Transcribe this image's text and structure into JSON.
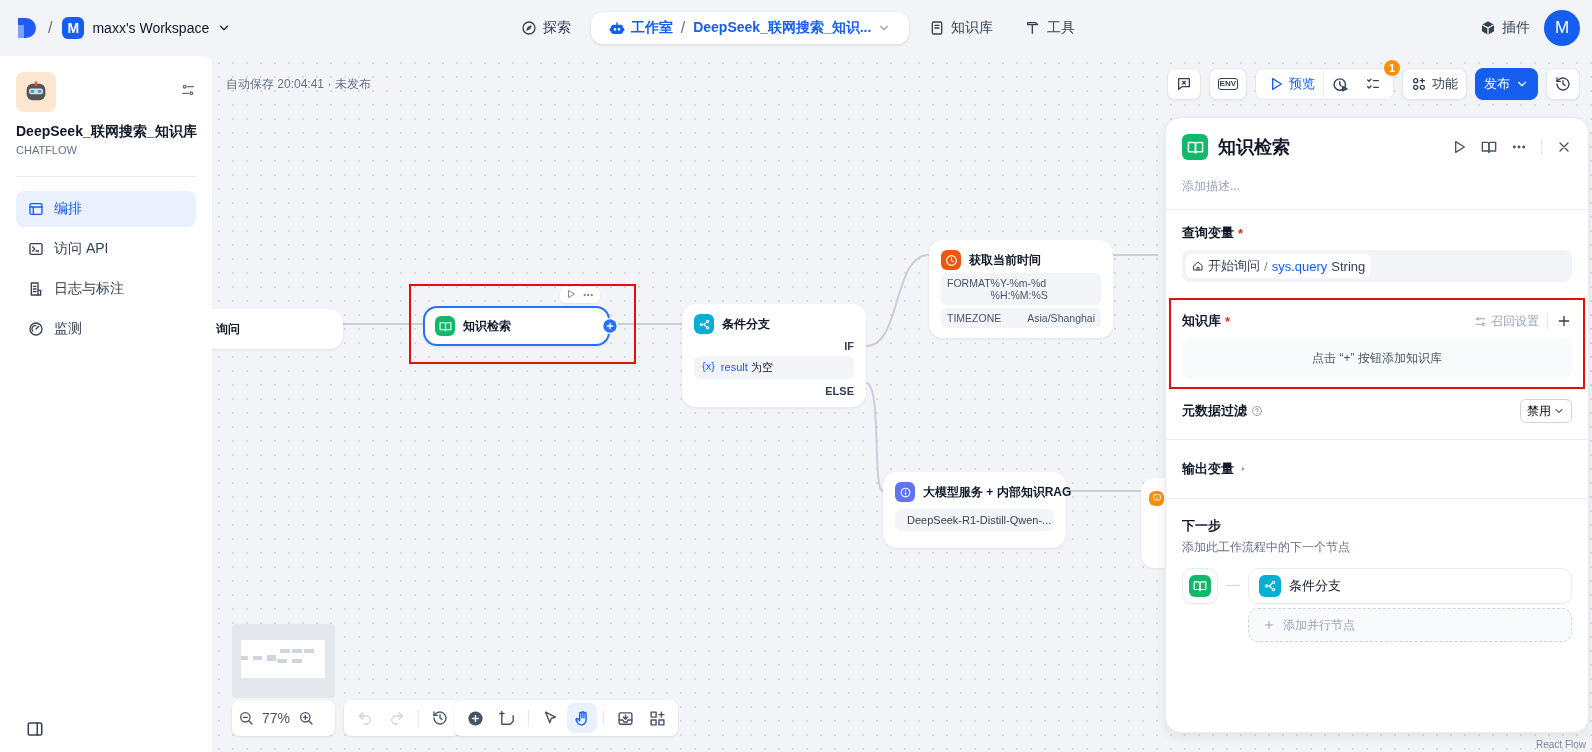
{
  "top_nav": {
    "separator": "/",
    "workspace": {
      "initial": "M",
      "name": "maxx's Workspace"
    },
    "items": [
      {
        "kind": "explore",
        "label": "探索",
        "selected": false
      },
      {
        "kind": "studio",
        "label": "工作室",
        "selected": true,
        "current_app": "DeepSeek_联网搜索_知识..."
      },
      {
        "kind": "knowledge",
        "label": "知识库",
        "selected": false
      },
      {
        "kind": "tools",
        "label": "工具",
        "selected": false
      }
    ],
    "plugins": "插件",
    "avatar": "M"
  },
  "sidebar": {
    "app_name": "DeepSeek_联网搜索_知识库",
    "app_type": "CHATFLOW",
    "items": [
      {
        "kind": "orchestrate",
        "label": "编排",
        "selected": true
      },
      {
        "kind": "api",
        "label": "访问 API",
        "selected": false
      },
      {
        "kind": "logs",
        "label": "日志与标注",
        "selected": false
      },
      {
        "kind": "monitor",
        "label": "监测",
        "selected": false
      }
    ]
  },
  "canvas": {
    "status": "自动保存 20:04:41 · 未发布",
    "header_actions": [
      {
        "kind": "conversation_vars"
      },
      {
        "kind": "env",
        "label": "ENV"
      },
      {
        "kind": "preview",
        "label": "预览"
      },
      {
        "kind": "run_history"
      },
      {
        "kind": "checklist",
        "badge": "1"
      },
      {
        "kind": "features",
        "label": "功能"
      },
      {
        "kind": "publish",
        "label": "发布"
      },
      {
        "kind": "versions"
      }
    ],
    "nodes": [
      {
        "kind": "start",
        "title": "询问",
        "selected": false,
        "highlighted": false
      },
      {
        "kind": "knowledge",
        "title": "知识检索",
        "selected": true,
        "highlighted": true
      },
      {
        "kind": "if_else",
        "title": "条件分支",
        "selected": false,
        "highlighted": false,
        "cases": [
          {
            "label": "IF",
            "condition": {
              "icon": "{x}",
              "variable": "result",
              "operator": "为空"
            }
          },
          {
            "label": "ELSE"
          }
        ]
      },
      {
        "kind": "tool",
        "title": "获取当前时间",
        "selected": false,
        "highlighted": false,
        "params": [
          {
            "key": "FORMAT",
            "value": "%Y-%m-%d %H:%M:%S"
          },
          {
            "key": "TIMEZONE",
            "value": "Asia/Shanghai"
          }
        ]
      },
      {
        "kind": "llm",
        "title": "大模型服务 + 内部知识RAG",
        "selected": false,
        "highlighted": false,
        "model": "DeepSeek-R1-Distill-Qwen-..."
      },
      {
        "kind": "answer",
        "selected": false,
        "highlighted": false
      }
    ],
    "zoom": "77%",
    "history_tools": [
      {
        "kind": "undo",
        "disabled": true
      },
      {
        "kind": "redo",
        "disabled": true
      },
      {
        "kind": "history",
        "disabled": false
      }
    ],
    "canvas_tools": [
      {
        "kind": "add_node",
        "selected": false
      },
      {
        "kind": "add_note",
        "selected": false
      },
      {
        "kind": "pointer",
        "selected": false
      },
      {
        "kind": "hand",
        "selected": true
      },
      {
        "kind": "export",
        "selected": false
      },
      {
        "kind": "layout",
        "selected": false
      }
    ],
    "attribution": "React Flow"
  },
  "panel": {
    "title": "知识检索",
    "description_placeholder": "添加描述...",
    "query_label": "查询变量",
    "required_mark": "*",
    "query": {
      "node": "开始询问",
      "separator": "/",
      "variable": "sys.query",
      "type": "String"
    },
    "kb_label": "知识库",
    "kb_highlighted": true,
    "recall_settings": "召回设置",
    "recall_disabled": true,
    "kb_empty": "点击 “+” 按钮添加知识库",
    "metadata_label": "元数据过滤",
    "metadata_value": "禁用",
    "output_label": "输出变量",
    "output_expanded": false,
    "next_label": "下一步",
    "next_hint": "添加此工作流程中的下一个节点",
    "next_node": {
      "kind": "if_else",
      "title": "条件分支"
    },
    "add_parallel": "添加并行节点"
  }
}
